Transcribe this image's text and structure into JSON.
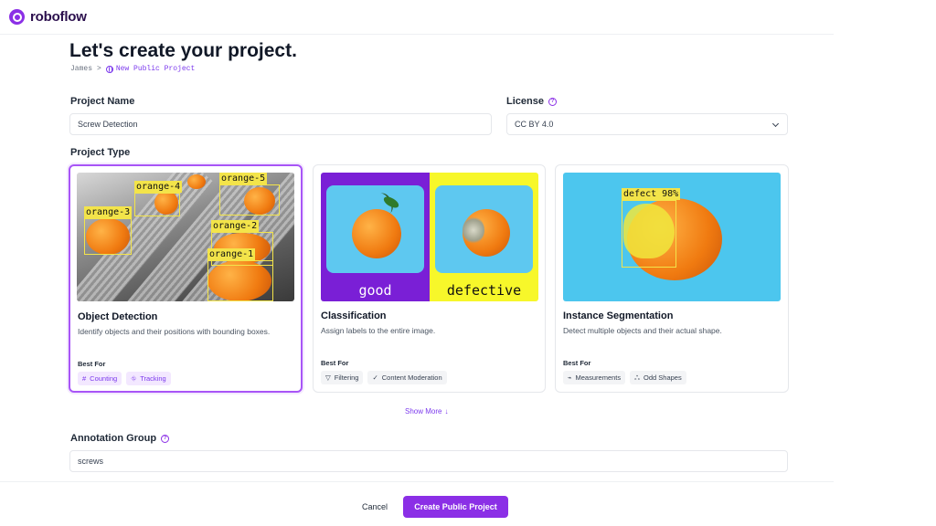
{
  "brand": {
    "name": "roboflow",
    "color": "#8b2fe6"
  },
  "page": {
    "title": "Let's create your project.",
    "breadcrumb": {
      "parent": "James",
      "separator": ">",
      "current": "New Public Project"
    }
  },
  "form": {
    "project_name": {
      "label": "Project Name",
      "value": "Screw Detection"
    },
    "license": {
      "label": "License",
      "value": "CC BY 4.0",
      "help_icon": "question-circle-icon"
    },
    "project_type_label": "Project Type",
    "annotation_group": {
      "label": "Annotation Group",
      "value": "screws",
      "help_icon": "question-circle-icon"
    }
  },
  "project_types": [
    {
      "title": "Object Detection",
      "description": "Identify objects and their positions with bounding boxes.",
      "best_for_label": "Best For",
      "selected": true,
      "tags": [
        {
          "icon": "#",
          "label": "Counting"
        },
        {
          "icon": "⛗",
          "label": "Tracking"
        }
      ],
      "image_labels": [
        "orange-4",
        "orange-5",
        "orange-3",
        "orange-2",
        "orange-1"
      ]
    },
    {
      "title": "Classification",
      "description": "Assign labels to the entire image.",
      "best_for_label": "Best For",
      "selected": false,
      "tags": [
        {
          "icon": "▽",
          "label": "Filtering"
        },
        {
          "icon": "✓",
          "label": "Content Moderation"
        }
      ],
      "image_labels": [
        "good",
        "defective"
      ]
    },
    {
      "title": "Instance Segmentation",
      "description": "Detect multiple objects and their actual shape.",
      "best_for_label": "Best For",
      "selected": false,
      "tags": [
        {
          "icon": "⌁",
          "label": "Measurements"
        },
        {
          "icon": "ஃ",
          "label": "Odd Shapes"
        }
      ],
      "image_labels": [
        "defect 98%"
      ]
    }
  ],
  "show_more": {
    "label": "Show More",
    "icon": "↓"
  },
  "footer": {
    "cancel_label": "Cancel",
    "create_label": "Create Public Project"
  },
  "colors": {
    "accent": "#8b2fe6",
    "accent_light": "#f3e8ff",
    "bbox": "#f3e44a"
  }
}
